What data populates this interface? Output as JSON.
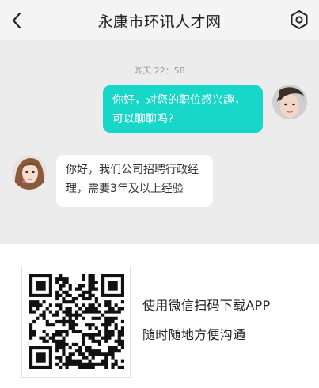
{
  "header": {
    "title": "永康市环讯人才网",
    "back_icon": "chevron-left-icon",
    "settings_icon": "gear-icon"
  },
  "chat": {
    "timestamp": "昨天  22：58",
    "messages": [
      {
        "side": "right",
        "text": "你好，对您的职位感兴趣，可以聊聊吗?",
        "avatar": "male-avatar"
      },
      {
        "side": "left",
        "text": "你好，我们公司招聘行政经理，需要3年及以上经验",
        "avatar": "female-avatar"
      }
    ],
    "colors": {
      "sent_bubble": "#17d7c9",
      "received_bubble": "#ffffff",
      "background": "#ececec"
    }
  },
  "promo": {
    "line1": "使用微信扫码下载APP",
    "line2": "随时随地方便沟通",
    "qr_icon": "qr-code-icon"
  }
}
